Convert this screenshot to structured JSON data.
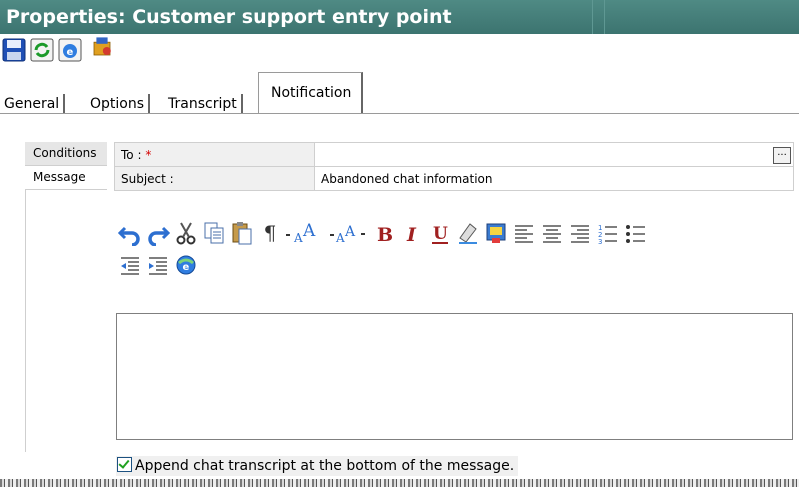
{
  "window": {
    "title": "Properties: Customer support entry point"
  },
  "toolbar": {
    "icons": [
      "save-icon",
      "refresh-icon",
      "browser-icon",
      "package-icon"
    ]
  },
  "tabs": [
    {
      "label": "General"
    },
    {
      "label": "Options"
    },
    {
      "label": "Transcript"
    },
    {
      "label": "Notification"
    }
  ],
  "sidenav": {
    "items": [
      {
        "label": "Conditions"
      },
      {
        "label": "Message"
      }
    ]
  },
  "form": {
    "to_label": "To :",
    "to_required": "*",
    "to_value": "",
    "browse_label": "...",
    "subject_label": "Subject :",
    "subject_value": "Abandoned chat information"
  },
  "editor_toolbar": {
    "paragraph_glyph": "¶",
    "icons": [
      "undo-icon",
      "redo-icon",
      "cut-icon",
      "copy-icon",
      "paste-icon",
      "paragraph-icon",
      "font-size-increase-icon",
      "font-size-decrease-icon",
      "bold-icon",
      "italic-icon",
      "underline-icon",
      "clear-format-icon",
      "highlight-icon",
      "align-left-icon",
      "align-center-icon",
      "align-right-icon",
      "numbered-list-icon",
      "bulleted-list-icon",
      "outdent-icon",
      "indent-icon",
      "insert-link-icon"
    ],
    "accent": "#2d6fd0"
  },
  "message": {
    "body": ""
  },
  "append": {
    "label": "Append chat transcript at the bottom of the message.",
    "checked": true
  }
}
